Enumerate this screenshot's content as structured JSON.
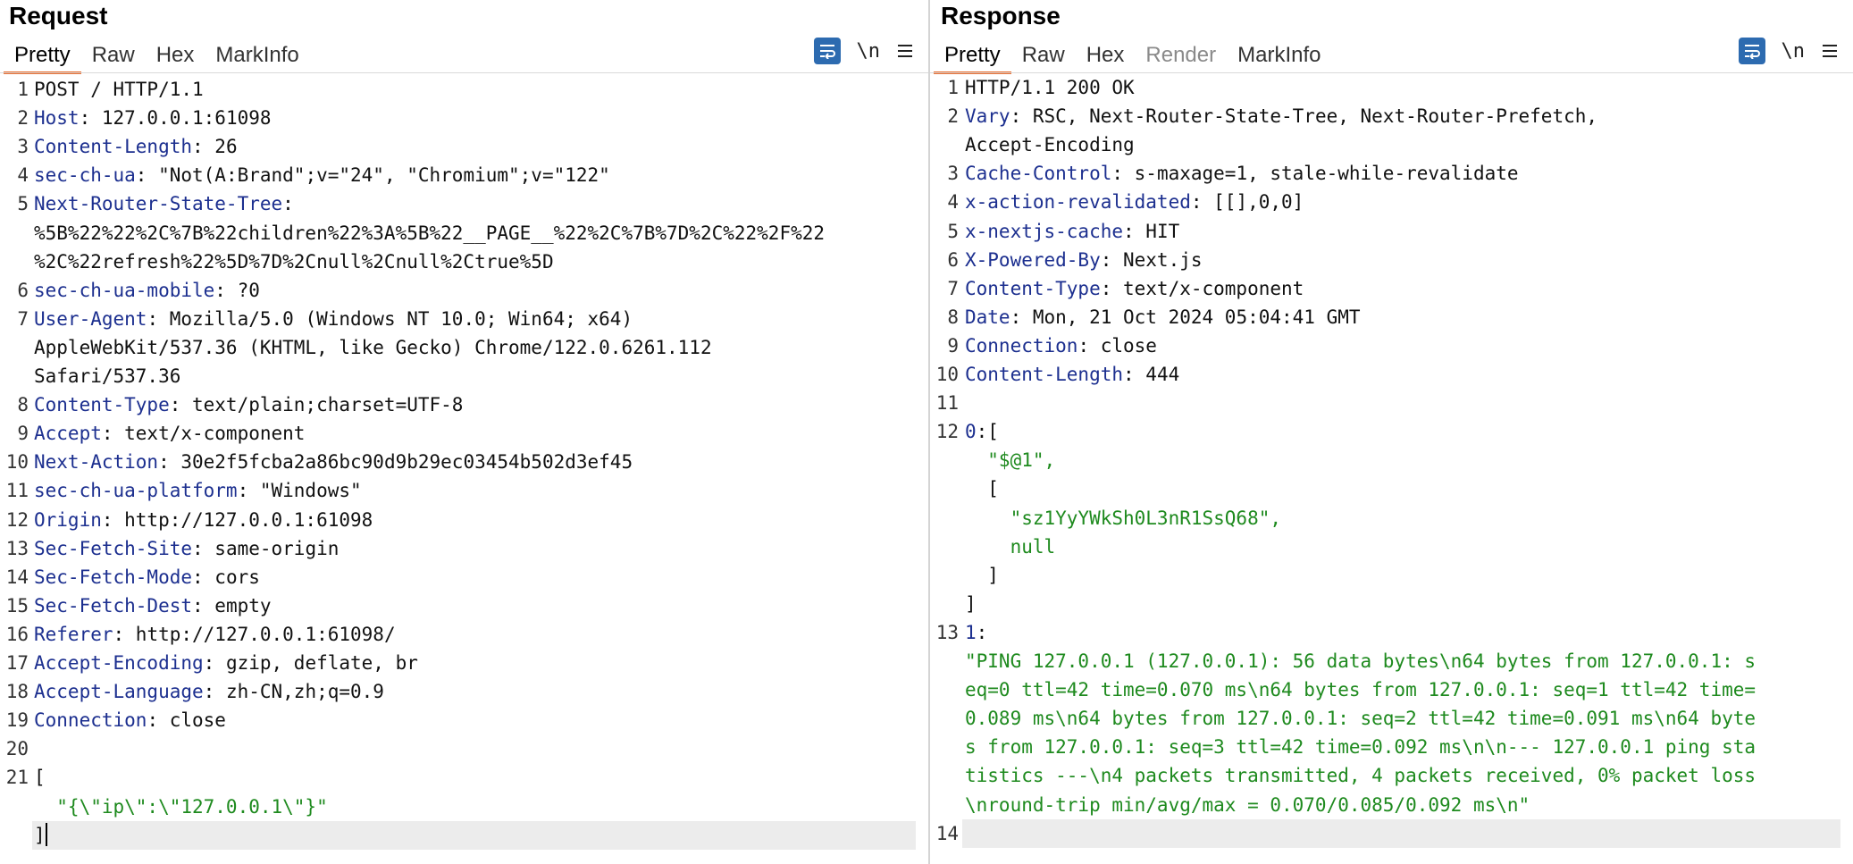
{
  "request": {
    "title": "Request",
    "tabs": [
      "Pretty",
      "Raw",
      "Hex",
      "MarkInfo"
    ],
    "active_tab": "Pretty",
    "tool_newline": "\\n",
    "lines": [
      {
        "n": "1",
        "key": "",
        "val": "POST / HTTP/1.1",
        "cls": ""
      },
      {
        "n": "2",
        "key": "Host",
        "val": ": 127.0.0.1:61098",
        "cls": ""
      },
      {
        "n": "3",
        "key": "Content-Length",
        "val": ": 26",
        "cls": ""
      },
      {
        "n": "4",
        "key": "sec-ch-ua",
        "val": ": \"Not(A:Brand\";v=\"24\", \"Chromium\";v=\"122\"",
        "cls": ""
      },
      {
        "n": "5",
        "key": "Next-Router-State-Tree",
        "val": ":",
        "cls": ""
      },
      {
        "n": "",
        "key": "",
        "val": "%5B%22%22%2C%7B%22children%22%3A%5B%22__PAGE__%22%2C%7B%7D%2C%22%2F%22",
        "cls": ""
      },
      {
        "n": "",
        "key": "",
        "val": "%2C%22refresh%22%5D%7D%2Cnull%2Cnull%2Ctrue%5D",
        "cls": ""
      },
      {
        "n": "6",
        "key": "sec-ch-ua-mobile",
        "val": ": ?0",
        "cls": ""
      },
      {
        "n": "7",
        "key": "User-Agent",
        "val": ": Mozilla/5.0 (Windows NT 10.0; Win64; x64)",
        "cls": ""
      },
      {
        "n": "",
        "key": "",
        "val": "AppleWebKit/537.36 (KHTML, like Gecko) Chrome/122.0.6261.112",
        "cls": ""
      },
      {
        "n": "",
        "key": "",
        "val": "Safari/537.36",
        "cls": ""
      },
      {
        "n": "8",
        "key": "Content-Type",
        "val": ": text/plain;charset=UTF-8",
        "cls": ""
      },
      {
        "n": "9",
        "key": "Accept",
        "val": ": text/x-component",
        "cls": ""
      },
      {
        "n": "10",
        "key": "Next-Action",
        "val": ": 30e2f5fcba2a86bc90d9b29ec03454b502d3ef45",
        "cls": ""
      },
      {
        "n": "11",
        "key": "sec-ch-ua-platform",
        "val": ": \"Windows\"",
        "cls": ""
      },
      {
        "n": "12",
        "key": "Origin",
        "val": ": http://127.0.0.1:61098",
        "cls": ""
      },
      {
        "n": "13",
        "key": "Sec-Fetch-Site",
        "val": ": same-origin",
        "cls": ""
      },
      {
        "n": "14",
        "key": "Sec-Fetch-Mode",
        "val": ": cors",
        "cls": ""
      },
      {
        "n": "15",
        "key": "Sec-Fetch-Dest",
        "val": ": empty",
        "cls": ""
      },
      {
        "n": "16",
        "key": "Referer",
        "val": ": http://127.0.0.1:61098/",
        "cls": ""
      },
      {
        "n": "17",
        "key": "Accept-Encoding",
        "val": ": gzip, deflate, br",
        "cls": ""
      },
      {
        "n": "18",
        "key": "Accept-Language",
        "val": ": zh-CN,zh;q=0.9",
        "cls": ""
      },
      {
        "n": "19",
        "key": "Connection",
        "val": ": close",
        "cls": ""
      },
      {
        "n": "20",
        "key": "",
        "val": "",
        "cls": ""
      },
      {
        "n": "21",
        "key": "",
        "val": "[",
        "cls": ""
      },
      {
        "n": "",
        "key": "",
        "val": "  \"{\\\"ip\\\":\\\"127.0.0.1\\\"}\"",
        "cls": "g"
      },
      {
        "n": "",
        "key": "",
        "val": "]",
        "cls": "",
        "caret": true
      }
    ]
  },
  "response": {
    "title": "Response",
    "tabs": [
      "Pretty",
      "Raw",
      "Hex",
      "Render",
      "MarkInfo"
    ],
    "active_tab": "Pretty",
    "disabled_tab": "Render",
    "tool_newline": "\\n",
    "lines": [
      {
        "n": "1",
        "key": "",
        "val": "HTTP/1.1 200 OK",
        "cls": ""
      },
      {
        "n": "2",
        "key": "Vary",
        "val": ": RSC, Next-Router-State-Tree, Next-Router-Prefetch,",
        "cls": ""
      },
      {
        "n": "",
        "key": "",
        "val": "Accept-Encoding",
        "cls": ""
      },
      {
        "n": "3",
        "key": "Cache-Control",
        "val": ": s-maxage=1, stale-while-revalidate",
        "cls": ""
      },
      {
        "n": "4",
        "key": "x-action-revalidated",
        "val": ": [[],0,0]",
        "cls": ""
      },
      {
        "n": "5",
        "key": "x-nextjs-cache",
        "val": ": HIT",
        "cls": ""
      },
      {
        "n": "6",
        "key": "X-Powered-By",
        "val": ": Next.js",
        "cls": ""
      },
      {
        "n": "7",
        "key": "Content-Type",
        "val": ": text/x-component",
        "cls": ""
      },
      {
        "n": "8",
        "key": "Date",
        "val": ": Mon, 21 Oct 2024 05:04:41 GMT",
        "cls": ""
      },
      {
        "n": "9",
        "key": "Connection",
        "val": ": close",
        "cls": ""
      },
      {
        "n": "10",
        "key": "Content-Length",
        "val": ": 444",
        "cls": ""
      },
      {
        "n": "11",
        "key": "",
        "val": "",
        "cls": ""
      },
      {
        "n": "12",
        "key": "0",
        "val": ":[",
        "cls": ""
      },
      {
        "n": "",
        "key": "",
        "val": "  \"$@1\",",
        "cls": "g"
      },
      {
        "n": "",
        "key": "",
        "val": "  [",
        "cls": ""
      },
      {
        "n": "",
        "key": "",
        "val": "    \"sz1YyYWkSh0L3nR1SsQ68\",",
        "cls": "g"
      },
      {
        "n": "",
        "key": "",
        "val": "    null",
        "cls": "g"
      },
      {
        "n": "",
        "key": "",
        "val": "  ]",
        "cls": ""
      },
      {
        "n": "",
        "key": "",
        "val": "]",
        "cls": ""
      },
      {
        "n": "13",
        "key": "1",
        "val": ":",
        "cls": ""
      },
      {
        "n": "",
        "key": "",
        "val": "\"PING 127.0.0.1 (127.0.0.1): 56 data bytes\\n64 bytes from 127.0.0.1: s",
        "cls": "g"
      },
      {
        "n": "",
        "key": "",
        "val": "eq=0 ttl=42 time=0.070 ms\\n64 bytes from 127.0.0.1: seq=1 ttl=42 time=",
        "cls": "g"
      },
      {
        "n": "",
        "key": "",
        "val": "0.089 ms\\n64 bytes from 127.0.0.1: seq=2 ttl=42 time=0.091 ms\\n64 byte",
        "cls": "g"
      },
      {
        "n": "",
        "key": "",
        "val": "s from 127.0.0.1: seq=3 ttl=42 time=0.092 ms\\n\\n--- 127.0.0.1 ping sta",
        "cls": "g"
      },
      {
        "n": "",
        "key": "",
        "val": "tistics ---\\n4 packets transmitted, 4 packets received, 0% packet loss",
        "cls": "g"
      },
      {
        "n": "",
        "key": "",
        "val": "\\nround-trip min/avg/max = 0.070/0.085/0.092 ms\\n\"",
        "cls": "g"
      },
      {
        "n": "14",
        "key": "",
        "val": "",
        "cls": "",
        "current": true
      }
    ]
  }
}
